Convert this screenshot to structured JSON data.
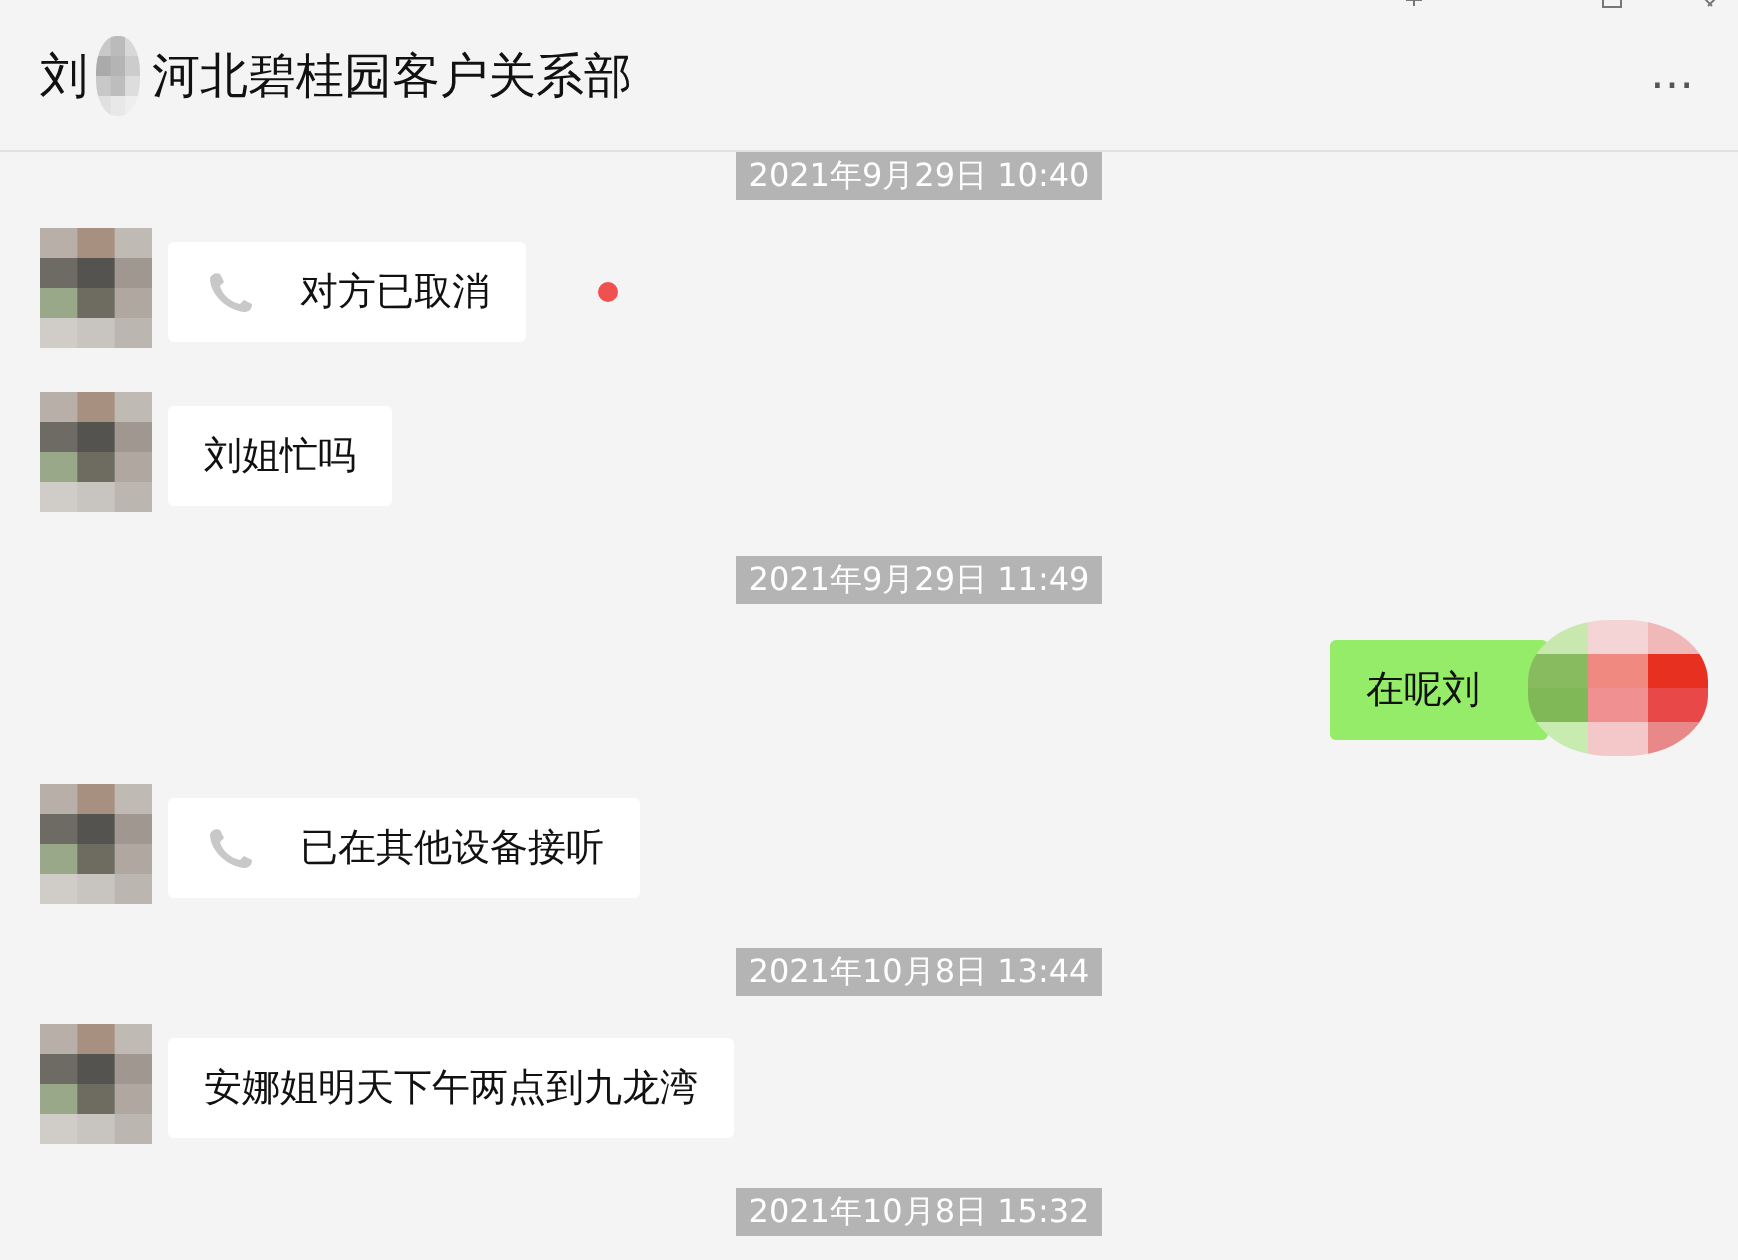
{
  "window": {
    "title_prefix": "刘",
    "title": "河北碧桂园客户关系部",
    "more": "…"
  },
  "messages": [
    {
      "kind": "time",
      "text": "2021年9月29日 10:40"
    },
    {
      "kind": "call",
      "outgoing": false,
      "text": "对方已取消",
      "unread": true
    },
    {
      "kind": "text",
      "outgoing": false,
      "text": "刘姐忙吗"
    },
    {
      "kind": "time",
      "text": "2021年9月29日 11:49"
    },
    {
      "kind": "text",
      "outgoing": true,
      "text": "在呢刘"
    },
    {
      "kind": "call",
      "outgoing": false,
      "text": "已在其他设备接听",
      "unread": false
    },
    {
      "kind": "time",
      "text": "2021年10月8日 13:44"
    },
    {
      "kind": "text",
      "outgoing": false,
      "text": "安娜姐明天下午两点到九龙湾"
    },
    {
      "kind": "time",
      "text": "2021年10月8日 15:32"
    }
  ]
}
